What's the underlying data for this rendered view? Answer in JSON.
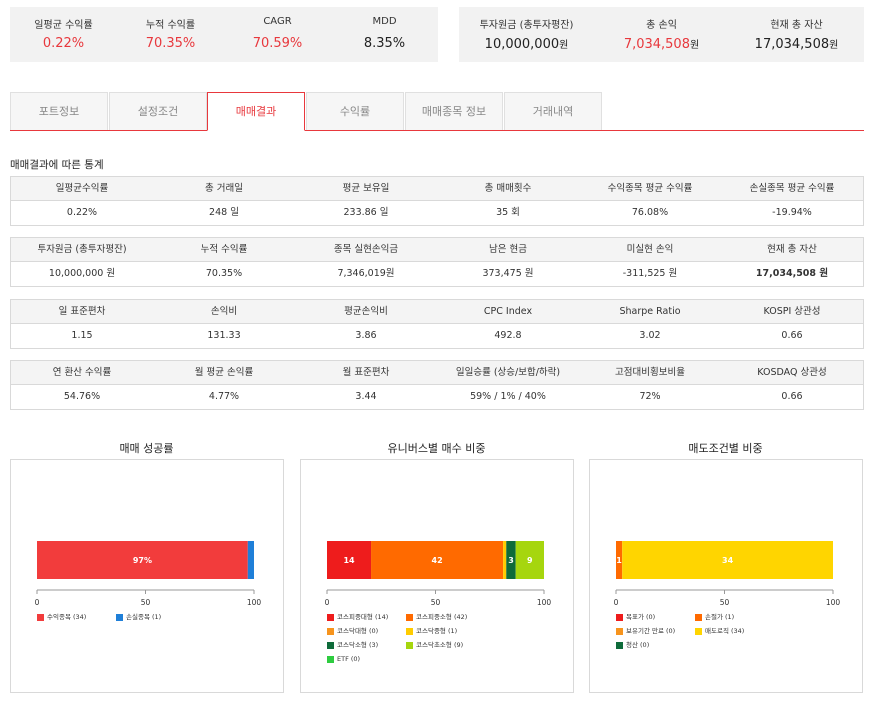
{
  "summary_left": [
    {
      "label": "일평균 수익률",
      "value": "0.22%",
      "color": "red"
    },
    {
      "label": "누적 수익률",
      "value": "70.35%",
      "color": "red"
    },
    {
      "label": "CAGR",
      "value": "70.59%",
      "color": "red"
    },
    {
      "label": "MDD",
      "value": "8.35%",
      "color": "black"
    }
  ],
  "summary_right": [
    {
      "label": "투자원금 (총투자평잔)",
      "value": "10,000,000",
      "unit": "원",
      "color": "black"
    },
    {
      "label": "총 손익",
      "value": "7,034,508",
      "unit": "원",
      "color": "red"
    },
    {
      "label": "현재 총 자산",
      "value": "17,034,508",
      "unit": "원",
      "color": "black"
    }
  ],
  "tabs": [
    "포트정보",
    "설정조건",
    "매매결과",
    "수익률",
    "매매종목 정보",
    "거래내역"
  ],
  "active_tab": 2,
  "section_title": "매매결과에 따른 통계",
  "tables": [
    {
      "headers": [
        "일평균수익률",
        "총 거래일",
        "평균 보유일",
        "총 매매횟수",
        "수익종목 평균 수익률",
        "손실종목 평균 수익률"
      ],
      "values": [
        "0.22%",
        "248 일",
        "233.86 일",
        "35 회",
        "76.08%",
        "-19.94%"
      ],
      "styles": [
        "red",
        "",
        "",
        "",
        "red big",
        "blue big"
      ]
    },
    {
      "headers": [
        "투자원금 (총투자평잔)",
        "누적 수익률",
        "종목 실현손익금",
        "남은 현금",
        "미실현 손익",
        "현재 총 자산"
      ],
      "values": [
        "10,000,000 원",
        "70.35%",
        "7,346,019원",
        "373,475 원",
        "-311,525 원",
        "17,034,508 원"
      ],
      "styles": [
        "",
        "red big",
        "red big",
        "",
        "",
        "bold"
      ]
    },
    {
      "headers": [
        "일 표준편차",
        "손익비",
        "평균손익비",
        "CPC Index",
        "Sharpe Ratio",
        "KOSPI 상관성"
      ],
      "values": [
        "1.15",
        "131.33",
        "3.86",
        "492.8",
        "3.02",
        "0.66"
      ],
      "styles": [
        "",
        "",
        "",
        "",
        "",
        ""
      ]
    },
    {
      "headers": [
        "연 환산 수익률",
        "월 평균 손익률",
        "월 표준편차",
        "일일승률 (상승/보합/하락)",
        "고점대비횡보비율",
        "KOSDAQ 상관성"
      ],
      "values": [
        "54.76%",
        "4.77%",
        "3.44",
        "59% / 1% / 40%",
        "72%",
        "0.66"
      ],
      "styles": [
        "red big",
        "red big",
        "",
        "",
        "",
        ""
      ]
    }
  ],
  "charts": [
    {
      "title": "매매 성공률",
      "chart_data": {
        "type": "bar",
        "orientation": "horizontal-stacked",
        "xlim": [
          0,
          100
        ],
        "ticks": [
          "0",
          "50",
          "100"
        ],
        "series": [
          {
            "name": "수익종목",
            "value": 34,
            "label": "97%",
            "color": "#f23c3c"
          },
          {
            "name": "손실종목",
            "value": 1,
            "label": "",
            "color": "#1f7fd8"
          }
        ]
      },
      "legend": [
        {
          "text": "수익종목 (34)",
          "color": "#f23c3c"
        },
        {
          "text": "손실종목 (1)",
          "color": "#1f7fd8"
        }
      ]
    },
    {
      "title": "유니버스별 매수 비중",
      "chart_data": {
        "type": "bar",
        "orientation": "horizontal-stacked",
        "xlim": [
          0,
          100
        ],
        "ticks": [
          "0",
          "50",
          "100"
        ],
        "series": [
          {
            "name": "코스피중대형",
            "value": 14,
            "label": "14",
            "color": "#ee1c1c"
          },
          {
            "name": "코스피중소형",
            "value": 42,
            "label": "42",
            "color": "#ff6a00"
          },
          {
            "name": "코스닥대형",
            "value": 0,
            "label": "",
            "color": "#f7941d"
          },
          {
            "name": "코스닥중형",
            "value": 1,
            "label": "",
            "color": "#ffcc00"
          },
          {
            "name": "코스닥소형",
            "value": 3,
            "label": "3",
            "color": "#0e6b3a"
          },
          {
            "name": "코스닥초소형",
            "value": 9,
            "label": "9",
            "color": "#a6d60e"
          },
          {
            "name": "ETF",
            "value": 0,
            "label": "",
            "color": "#2ecc40"
          }
        ]
      },
      "legend": [
        {
          "text": "코스피중대형 (14)",
          "color": "#ee1c1c"
        },
        {
          "text": "코스피중소형 (42)",
          "color": "#ff6a00"
        },
        {
          "text": "코스닥대형 (0)",
          "color": "#f7941d"
        },
        {
          "text": "코스닥중형 (1)",
          "color": "#ffcc00"
        },
        {
          "text": "코스닥소형 (3)",
          "color": "#0e6b3a"
        },
        {
          "text": "코스닥초소형 (9)",
          "color": "#a6d60e"
        },
        {
          "text": "ETF (0)",
          "color": "#2ecc40"
        }
      ]
    },
    {
      "title": "매도조건별 비중",
      "chart_data": {
        "type": "bar",
        "orientation": "horizontal-stacked",
        "xlim": [
          0,
          100
        ],
        "ticks": [
          "0",
          "50",
          "100"
        ],
        "series": [
          {
            "name": "목표가",
            "value": 0,
            "label": "",
            "color": "#ee1c1c"
          },
          {
            "name": "손절가",
            "value": 1,
            "label": "1",
            "color": "#ff6a00"
          },
          {
            "name": "보유기간 만료",
            "value": 0,
            "label": "",
            "color": "#f7941d"
          },
          {
            "name": "매도로직",
            "value": 34,
            "label": "34",
            "color": "#ffd500"
          },
          {
            "name": "청산",
            "value": 0,
            "label": "",
            "color": "#0e6b3a"
          }
        ]
      },
      "legend": [
        {
          "text": "목표가 (0)",
          "color": "#ee1c1c"
        },
        {
          "text": "손절가 (1)",
          "color": "#ff6a00"
        },
        {
          "text": "보유기간 만료 (0)",
          "color": "#f7941d"
        },
        {
          "text": "매도로직 (34)",
          "color": "#ffd500"
        },
        {
          "text": "청산 (0)",
          "color": "#0e6b3a"
        }
      ]
    }
  ],
  "colors": {
    "accent": "#e8383d",
    "negative": "#2d6fd1"
  }
}
